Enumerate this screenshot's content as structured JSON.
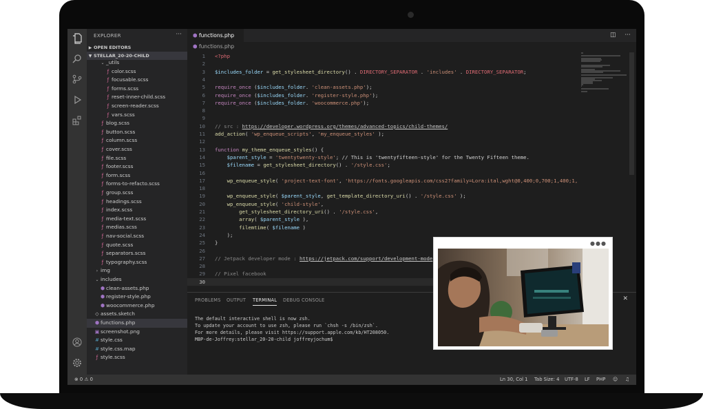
{
  "explorer": {
    "title": "EXPLORER",
    "more": "···",
    "open_editors": "OPEN EDITORS",
    "project": "STELLAR_20-20-CHILD"
  },
  "tree": [
    {
      "label": "_utils",
      "icon": "chevron-down",
      "indent": 1
    },
    {
      "label": "color.scss",
      "icon": "scss",
      "indent": 2
    },
    {
      "label": "focusable.scss",
      "icon": "scss",
      "indent": 2
    },
    {
      "label": "forms.scss",
      "icon": "scss",
      "indent": 2
    },
    {
      "label": "reset-inner-child.scss",
      "icon": "scss",
      "indent": 2
    },
    {
      "label": "screen-reader.scss",
      "icon": "scss",
      "indent": 2
    },
    {
      "label": "vars.scss",
      "icon": "scss",
      "indent": 2
    },
    {
      "label": "blog.scss",
      "icon": "scss",
      "indent": 1
    },
    {
      "label": "button.scss",
      "icon": "scss",
      "indent": 1
    },
    {
      "label": "column.scss",
      "icon": "scss",
      "indent": 1
    },
    {
      "label": "cover.scss",
      "icon": "scss",
      "indent": 1
    },
    {
      "label": "file.scss",
      "icon": "scss",
      "indent": 1
    },
    {
      "label": "footer.scss",
      "icon": "scss",
      "indent": 1
    },
    {
      "label": "form.scss",
      "icon": "scss",
      "indent": 1
    },
    {
      "label": "forms-to-refacto.scss",
      "icon": "scss",
      "indent": 1
    },
    {
      "label": "group.scss",
      "icon": "scss",
      "indent": 1
    },
    {
      "label": "headings.scss",
      "icon": "scss",
      "indent": 1
    },
    {
      "label": "index.scss",
      "icon": "scss",
      "indent": 1
    },
    {
      "label": "media-text.scss",
      "icon": "scss",
      "indent": 1
    },
    {
      "label": "medias.scss",
      "icon": "scss",
      "indent": 1
    },
    {
      "label": "nav-social.scss",
      "icon": "scss",
      "indent": 1
    },
    {
      "label": "quote.scss",
      "icon": "scss",
      "indent": 1
    },
    {
      "label": "separators.scss",
      "icon": "scss",
      "indent": 1
    },
    {
      "label": "typography.scss",
      "icon": "scss",
      "indent": 1
    },
    {
      "label": "img",
      "icon": "chevron-right",
      "indent": 0
    },
    {
      "label": "includes",
      "icon": "chevron-down",
      "indent": 0
    },
    {
      "label": "clean-assets.php",
      "icon": "php",
      "indent": 1
    },
    {
      "label": "register-style.php",
      "icon": "php",
      "indent": 1
    },
    {
      "label": "woocommerce.php",
      "icon": "php",
      "indent": 1
    },
    {
      "label": "assets.sketch",
      "icon": "sketch",
      "indent": 0
    },
    {
      "label": "functions.php",
      "icon": "php",
      "indent": 0,
      "selected": true
    },
    {
      "label": "screenshot.png",
      "icon": "img",
      "indent": 0
    },
    {
      "label": "style.css",
      "icon": "css",
      "indent": 0
    },
    {
      "label": "style.css.map",
      "icon": "css",
      "indent": 0
    },
    {
      "label": "style.scss",
      "icon": "scss",
      "indent": 0
    }
  ],
  "editor": {
    "tab_label": "functions.php",
    "breadcrumb": "functions.php",
    "lines": [
      {
        "n": "1",
        "tokens": [
          [
            "php",
            "<?php"
          ]
        ]
      },
      {
        "n": "2",
        "tokens": []
      },
      {
        "n": "3",
        "tokens": [
          [
            "var",
            "$includes_folder"
          ],
          [
            "op",
            " = "
          ],
          [
            "fn",
            "get_stylesheet_directory"
          ],
          [
            "op",
            "() . "
          ],
          [
            "const",
            "DIRECTORY_SEPARATOR"
          ],
          [
            "op",
            " . "
          ],
          [
            "str",
            "'includes'"
          ],
          [
            "op",
            " . "
          ],
          [
            "const",
            "DIRECTORY_SEPARATOR"
          ],
          [
            "op",
            ";"
          ]
        ]
      },
      {
        "n": "4",
        "tokens": []
      },
      {
        "n": "5",
        "tokens": [
          [
            "kw",
            "require_once"
          ],
          [
            "op",
            " ("
          ],
          [
            "var",
            "$includes_folder"
          ],
          [
            "op",
            ". "
          ],
          [
            "str",
            "'clean-assets.php'"
          ],
          [
            "op",
            ");"
          ]
        ]
      },
      {
        "n": "6",
        "tokens": [
          [
            "kw",
            "require_once"
          ],
          [
            "op",
            " ("
          ],
          [
            "var",
            "$includes_folder"
          ],
          [
            "op",
            ". "
          ],
          [
            "str",
            "'register-style.php'"
          ],
          [
            "op",
            ");"
          ]
        ]
      },
      {
        "n": "7",
        "tokens": [
          [
            "kw",
            "require_once"
          ],
          [
            "op",
            " ("
          ],
          [
            "var",
            "$includes_folder"
          ],
          [
            "op",
            ". "
          ],
          [
            "str",
            "'woocommerce.php'"
          ],
          [
            "op",
            ");"
          ]
        ]
      },
      {
        "n": "8",
        "tokens": []
      },
      {
        "n": "9",
        "tokens": []
      },
      {
        "n": "10",
        "tokens": [
          [
            "com",
            "// src : "
          ],
          [
            "link",
            "https://developer.wordpress.org/themes/advanced-topics/child-themes/"
          ]
        ]
      },
      {
        "n": "11",
        "tokens": [
          [
            "fn",
            "add_action"
          ],
          [
            "op",
            "( "
          ],
          [
            "str",
            "'wp_enqueue_scripts'"
          ],
          [
            "op",
            ", "
          ],
          [
            "str",
            "'my_enqueue_styles'"
          ],
          [
            "op",
            " );"
          ]
        ]
      },
      {
        "n": "12",
        "tokens": []
      },
      {
        "n": "13",
        "tokens": [
          [
            "kw",
            "function"
          ],
          [
            "op",
            " "
          ],
          [
            "fn",
            "my_theme_enqueue_styles"
          ],
          [
            "op",
            "() {"
          ]
        ]
      },
      {
        "n": "14",
        "tokens": [
          [
            "op",
            "    "
          ],
          [
            "var",
            "$parent_style"
          ],
          [
            "op",
            " = "
          ],
          [
            "str",
            "'twentytwenty-style'"
          ],
          [
            "op",
            "; // This is 'twentyfifteen-style' for the Twenty Fifteen theme."
          ]
        ]
      },
      {
        "n": "15",
        "tokens": [
          [
            "op",
            "    "
          ],
          [
            "var",
            "$filename"
          ],
          [
            "op",
            " = "
          ],
          [
            "fn",
            "get_stylesheet_directory"
          ],
          [
            "op",
            "() . "
          ],
          [
            "str",
            "'/style.css'"
          ],
          [
            "op",
            ";"
          ]
        ]
      },
      {
        "n": "16",
        "tokens": []
      },
      {
        "n": "17",
        "tokens": [
          [
            "op",
            "    "
          ],
          [
            "fn",
            "wp_enqueue_style"
          ],
          [
            "op",
            "( "
          ],
          [
            "str",
            "'project-text-font'"
          ],
          [
            "op",
            ", "
          ],
          [
            "str",
            "'https://fonts.googleapis.com/css2?family=Lora:ital,wght@0,400;0,700;1,400;1,"
          ]
        ]
      },
      {
        "n": "18",
        "tokens": []
      },
      {
        "n": "19",
        "tokens": [
          [
            "op",
            "    "
          ],
          [
            "fn",
            "wp_enqueue_style"
          ],
          [
            "op",
            "( "
          ],
          [
            "var",
            "$parent_style"
          ],
          [
            "op",
            ", "
          ],
          [
            "fn",
            "get_template_directory_uri"
          ],
          [
            "op",
            "() . "
          ],
          [
            "str",
            "'/style.css'"
          ],
          [
            "op",
            " );"
          ]
        ]
      },
      {
        "n": "20",
        "tokens": [
          [
            "op",
            "    "
          ],
          [
            "fn",
            "wp_enqueue_style"
          ],
          [
            "op",
            "( "
          ],
          [
            "str",
            "'child-style'"
          ],
          [
            "op",
            ","
          ]
        ]
      },
      {
        "n": "21",
        "tokens": [
          [
            "op",
            "        "
          ],
          [
            "fn",
            "get_stylesheet_directory_uri"
          ],
          [
            "op",
            "() . "
          ],
          [
            "str",
            "'/style.css'"
          ],
          [
            "op",
            ","
          ]
        ]
      },
      {
        "n": "22",
        "tokens": [
          [
            "op",
            "        "
          ],
          [
            "fn",
            "array"
          ],
          [
            "op",
            "( "
          ],
          [
            "var",
            "$parent_style"
          ],
          [
            "op",
            " ),"
          ]
        ]
      },
      {
        "n": "23",
        "tokens": [
          [
            "op",
            "        "
          ],
          [
            "fn",
            "filemtime"
          ],
          [
            "op",
            "( "
          ],
          [
            "var",
            "$filename"
          ],
          [
            "op",
            " )"
          ]
        ]
      },
      {
        "n": "24",
        "tokens": [
          [
            "op",
            "    );"
          ]
        ]
      },
      {
        "n": "25",
        "tokens": [
          [
            "op",
            "}"
          ]
        ]
      },
      {
        "n": "26",
        "tokens": []
      },
      {
        "n": "27",
        "tokens": [
          [
            "com",
            "// Jetpack developer mode : "
          ],
          [
            "link",
            "https://jetpack.com/support/development-mode"
          ]
        ]
      },
      {
        "n": "28",
        "tokens": []
      },
      {
        "n": "29",
        "tokens": [
          [
            "com",
            "// Pixel facebook"
          ]
        ]
      },
      {
        "n": "30",
        "tokens": [],
        "current": true
      }
    ]
  },
  "panel": {
    "tabs": [
      "PROBLEMS",
      "OUTPUT",
      "TERMINAL",
      "DEBUG CONSOLE"
    ],
    "active_tab": "TERMINAL",
    "close": "✕",
    "terminal_lines": [
      "The default interactive shell is now zsh.",
      "To update your account to use zsh, please run `chsh -s /bin/zsh`.",
      "For more details, please visit https://support.apple.com/kb/HT208050.",
      "MBP-de-Joffrey:stellar_20-20-child joffreyjochum$"
    ]
  },
  "status": {
    "problems": "⊗ 0 ⚠ 0",
    "position": "Ln 30, Col 1",
    "tab_size": "Tab Size: 4",
    "encoding": "UTF-8",
    "eol": "LF",
    "language": "PHP"
  },
  "pip": {
    "dots": "●●●"
  },
  "colors": {
    "keyword": "#c586c0",
    "variable": "#9cdcfe",
    "function": "#dcdcaa",
    "string": "#ce9178",
    "constant": "#e06c75",
    "scss": "#e06c9f",
    "php": "#a074c4",
    "css": "#519aba"
  }
}
